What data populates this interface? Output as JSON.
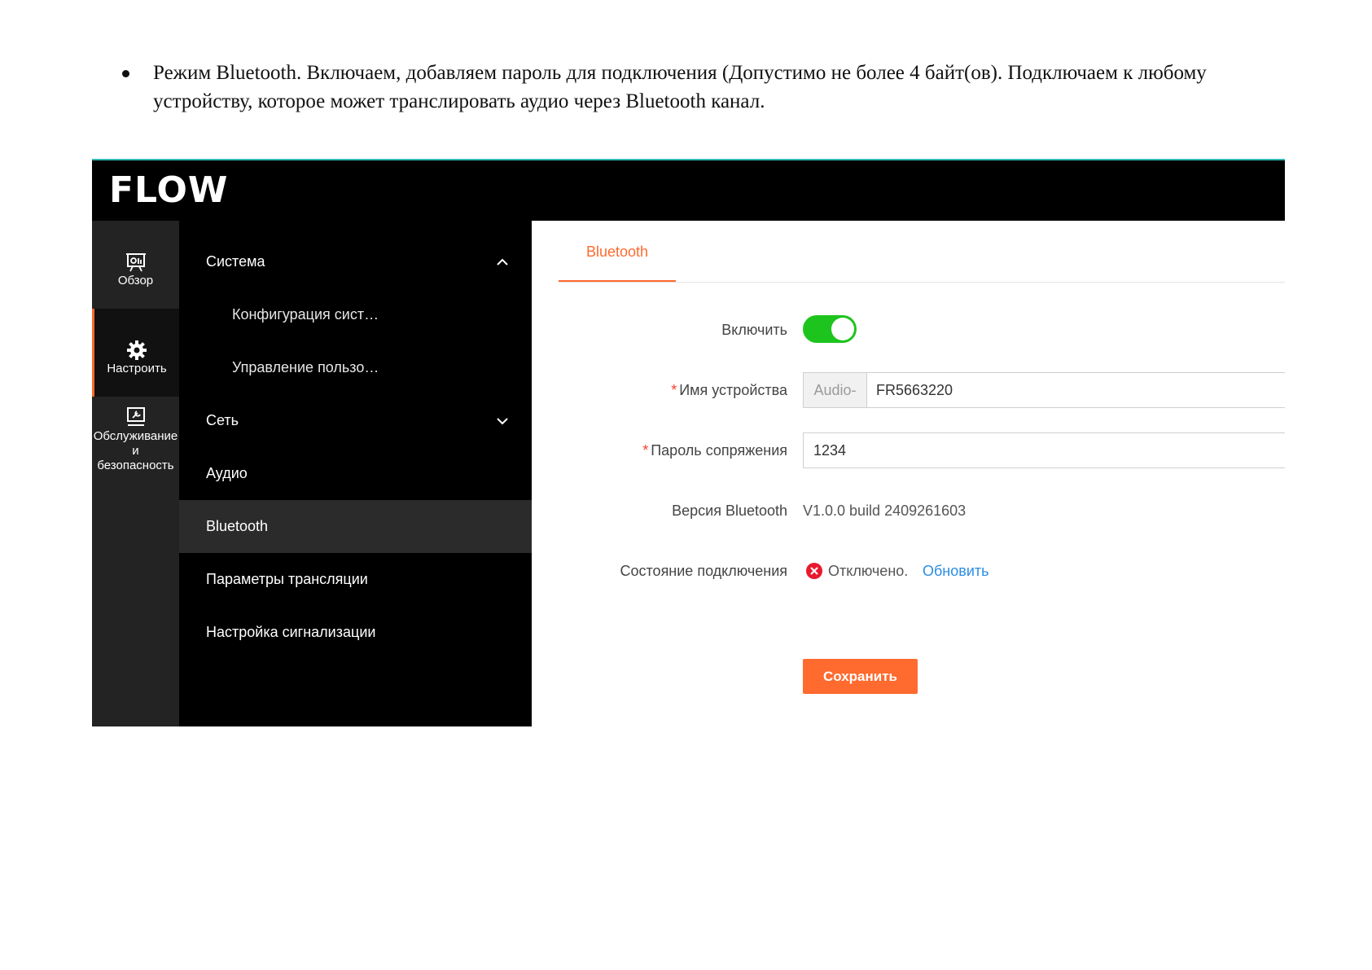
{
  "document": {
    "bullet_text": "Режим Bluetooth. Включаем, добавляем пароль для подключения (Допустимо не более 4 байт(ов). Подключаем к любому устройству, которое может транслировать аудио через Bluetooth канал."
  },
  "app": {
    "logo": "FLOW",
    "rail": [
      {
        "label": "Обзор",
        "icon": "dashboard-icon"
      },
      {
        "label": "Настроить",
        "icon": "gear-icon"
      },
      {
        "label_line1": "Обслуживание",
        "label_line2": "и",
        "label_line3": "безопасность",
        "icon": "maintenance-icon"
      }
    ],
    "submenu": {
      "system": "Система",
      "system_config": "Конфигурация сист…",
      "user_mgmt": "Управление пользо…",
      "network": "Сеть",
      "audio": "Аудио",
      "bluetooth": "Bluetooth",
      "stream_params": "Параметры трансляции",
      "alarm_settings": "Настройка сигнализации"
    },
    "tab": "Bluetooth",
    "form": {
      "enable_label": "Включить",
      "enable_on": true,
      "device_name_label": "Имя устройства",
      "device_name_prefix": "Audio-",
      "device_name_value": "FR5663220",
      "password_label": "Пароль сопряжения",
      "password_value": "1234",
      "version_label": "Версия Bluetooth",
      "version_value": "V1.0.0 build 2409261603",
      "status_label": "Состояние подключения",
      "status_value": "Отключено.",
      "refresh_link": "Обновить",
      "save_button": "Сохранить",
      "required_mark": "*"
    },
    "colors": {
      "accent": "#ff6a2e",
      "toggle_on": "#1ec41e",
      "link": "#2a8de3",
      "error": "#e8192c"
    }
  }
}
